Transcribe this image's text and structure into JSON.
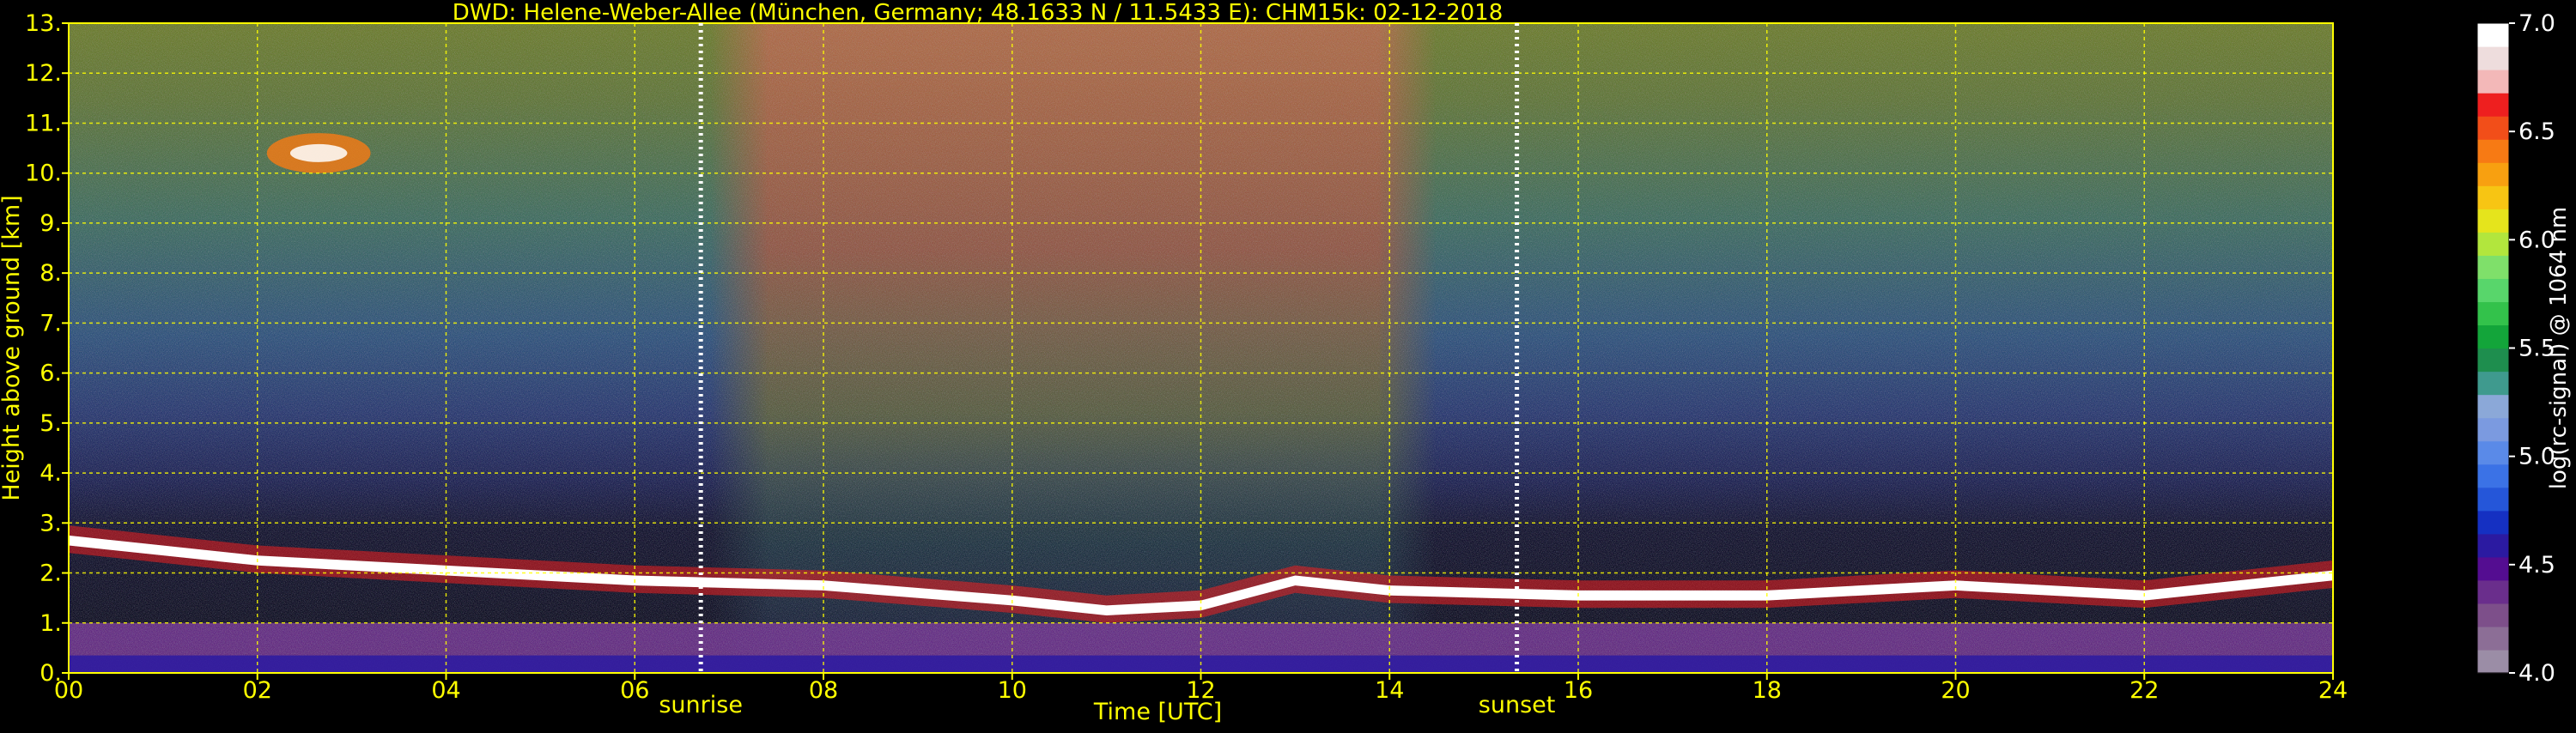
{
  "chart_data": [
    {
      "type": "heatmap",
      "title": "DWD: Helene-Weber-Allee (München, Germany; 48.1633 N / 11.5433 E):    CHM15k: 02-12-2018",
      "xlabel": "Time [UTC]",
      "ylabel": "Height above ground [km]",
      "xlim": [
        0,
        24
      ],
      "ylim": [
        0,
        13
      ],
      "x_ticks": [
        0,
        2,
        4,
        6,
        8,
        10,
        12,
        14,
        16,
        18,
        20,
        22,
        24
      ],
      "x_tick_labels": [
        "00",
        "02",
        "04",
        "06",
        "08",
        "10",
        "12",
        "14",
        "16",
        "18",
        "20",
        "22",
        "24"
      ],
      "y_ticks": [
        0,
        1,
        2,
        3,
        4,
        5,
        6,
        7,
        8,
        9,
        10,
        11,
        12,
        13
      ],
      "y_tick_labels": [
        "0.",
        "1.",
        "2.",
        "3.",
        "4.",
        "5.",
        "6.",
        "7.",
        "8.",
        "9.",
        "10.",
        "11.",
        "12.",
        "13."
      ],
      "grid": true,
      "annotations": [
        {
          "text": "sunrise",
          "x": 6.7
        },
        {
          "text": "sunset",
          "x": 15.35
        }
      ],
      "features": {
        "cloud_layer_km": [
          [
            0,
            2.6
          ],
          [
            2,
            2.2
          ],
          [
            3,
            2.1
          ],
          [
            5,
            1.9
          ],
          [
            6,
            1.8
          ],
          [
            8,
            1.7
          ],
          [
            10,
            1.4
          ],
          [
            11,
            1.2
          ],
          [
            12,
            1.3
          ],
          [
            13,
            1.8
          ],
          [
            14,
            1.6
          ],
          [
            16,
            1.5
          ],
          [
            18,
            1.5
          ],
          [
            20,
            1.7
          ],
          [
            22,
            1.5
          ],
          [
            24,
            1.9
          ]
        ],
        "upper_cloud": {
          "x_range": [
            2.1,
            3.2
          ],
          "y_range_km": [
            10.0,
            10.8
          ]
        },
        "solar_noise_x_range": [
          6.8,
          14.5
        ]
      },
      "colors": {
        "text": "#ffff00",
        "background": "#000000",
        "grid": "#ffff00"
      },
      "colorbar": {
        "label": "log(rc-signal) @ 1064 nm",
        "range": [
          4.0,
          7.0
        ],
        "ticks": [
          4.0,
          4.5,
          5.0,
          5.5,
          6.0,
          6.5,
          7.0
        ],
        "tick_labels": [
          "4.0",
          "4.5",
          "5.0",
          "5.5",
          "6.0",
          "6.5",
          "7.0"
        ],
        "colors": [
          "#9b8da6",
          "#8c6e96",
          "#7d4f8a",
          "#6a2e8c",
          "#540d91",
          "#2b1aa1",
          "#1530c2",
          "#2556d9",
          "#3b72e6",
          "#5a8ae8",
          "#7b9ae0",
          "#8ba8d8",
          "#3f9a8e",
          "#1e8e4e",
          "#13a53a",
          "#33c24b",
          "#58d66b",
          "#7fe06a",
          "#b2e63d",
          "#e5e41c",
          "#f7c513",
          "#f8a010",
          "#f77a14",
          "#f24e19",
          "#ee1f1f",
          "#f3b8b8",
          "#eedddd",
          "#ffffff"
        ]
      }
    }
  ]
}
